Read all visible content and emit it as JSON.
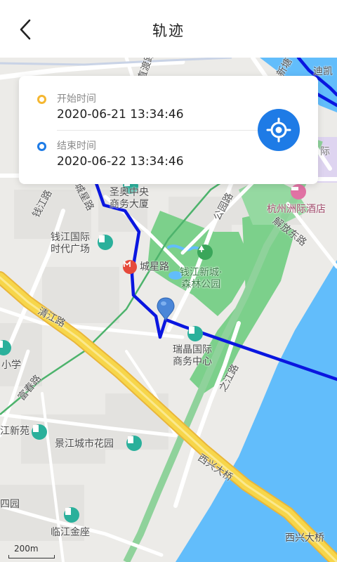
{
  "header": {
    "title": "轨迹"
  },
  "card": {
    "start_label": "开始时间",
    "start_time": "2020-06-21 13:34:46",
    "end_label": "结束时间",
    "end_time": "2020-06-22 13:34:46",
    "start_dot_color": "#f5b731",
    "end_dot_color": "#1e7be6",
    "locate_icon": "locate-crosshair-icon"
  },
  "map": {
    "track_color": "#0a16e0",
    "water_color": "#62bdfb",
    "park_color": "#7cd08b",
    "highway_color": "#f7d64a",
    "marker_color": "#4a86d8",
    "labels": {
      "top_road": "直渡路",
      "top_right_road": "新塘",
      "top_right_corner": "迪凯",
      "chengxing_road_vertical": "城星路",
      "qianjiang_road": "钱江路",
      "shengao": "圣奥中央\n商务大厦",
      "gongyuan_road": "公园路",
      "hangzhou_hotel": "杭州洲际酒店",
      "jiefang_east_road": "解放东路",
      "qianjiang_times": "钱江国际\n时代广场",
      "chengxing_road_station": "城星路",
      "forest_park": "钱江新城·\n森林公园",
      "qingjiang_road": "清江路",
      "ruijing": "瑞晶国际\n商务中心",
      "zhijiang_road": "之江路",
      "school": "小学",
      "fuchun_road": "富春路",
      "jiangxin_yuan": "江新苑",
      "jingjiang_garden": "景江城市花园",
      "xixing_bridge_diag": "西兴大桥",
      "si_yuan": "四园",
      "linjiang_jinzuo": "临江金座",
      "xixing_bridge": "西兴大桥",
      "right_edge_fragment": "际"
    },
    "scale_label": "200m"
  }
}
